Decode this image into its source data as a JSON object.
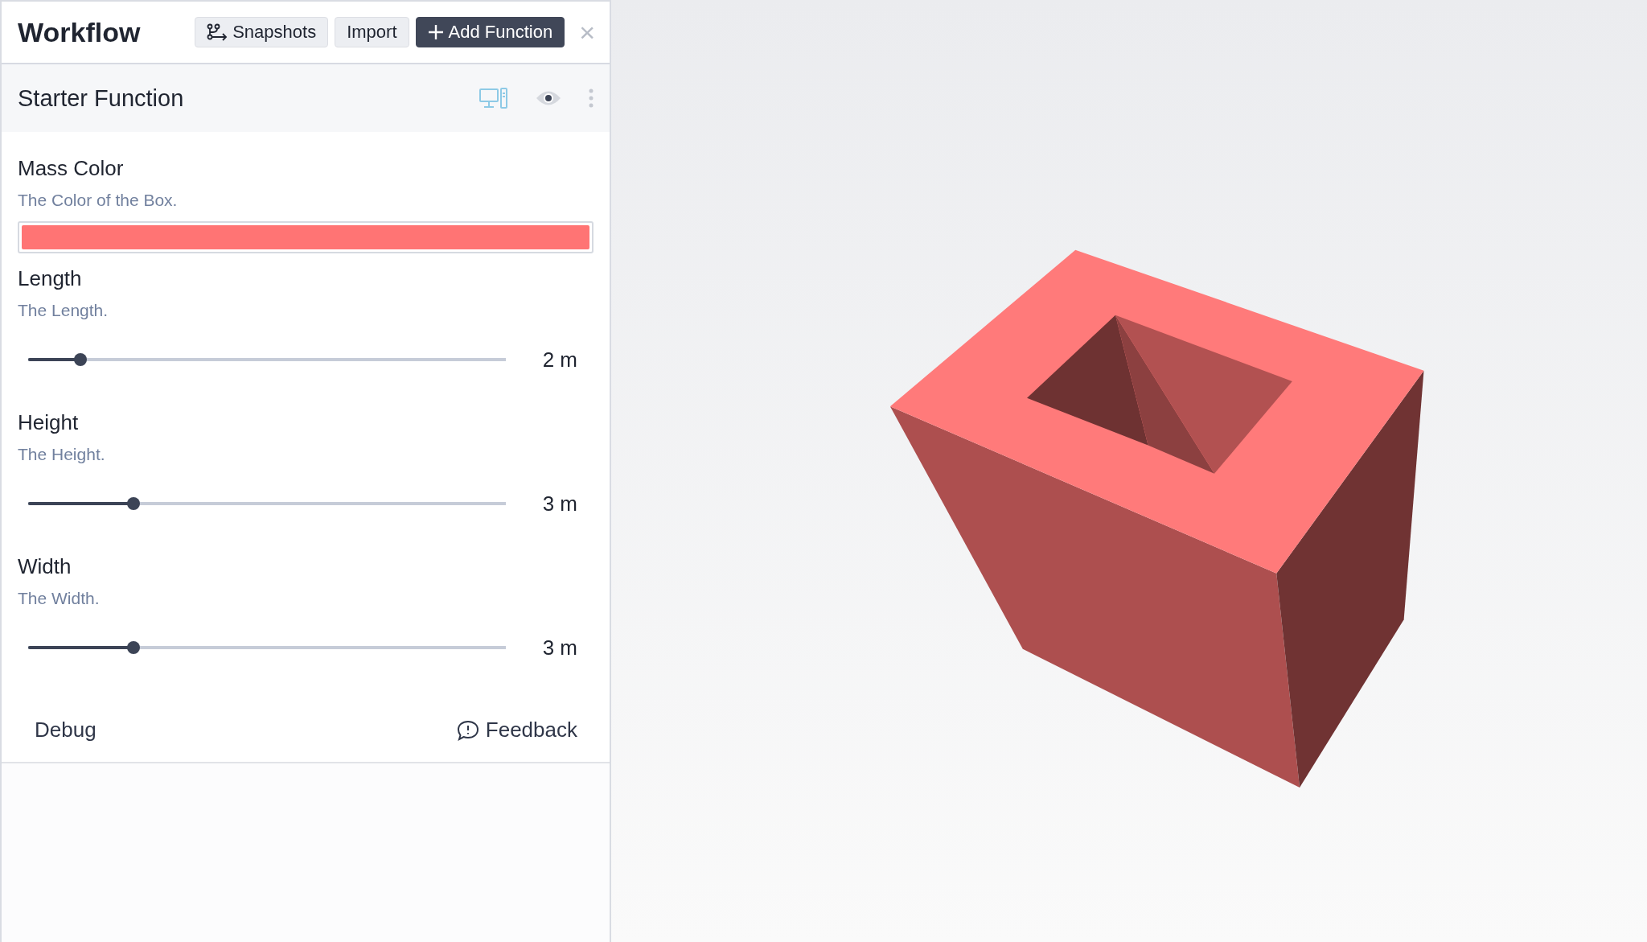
{
  "header": {
    "title": "Workflow",
    "buttons": [
      {
        "label": "Snapshots",
        "kind": "icon"
      },
      {
        "label": "Import",
        "kind": "plain"
      },
      {
        "label": "Add Function",
        "kind": "primary"
      }
    ],
    "close": "×"
  },
  "function": {
    "title": "Starter Function",
    "params": [
      {
        "kind": "color",
        "label": "Mass Color",
        "description": "The Color of the Box.",
        "color": "#ff7474"
      },
      {
        "kind": "slider",
        "label": "Length",
        "description": "The Length.",
        "level": 0.11,
        "reading": "2 m"
      },
      {
        "kind": "slider",
        "label": "Height",
        "description": "The Height.",
        "level": 0.22,
        "reading": "3 m"
      },
      {
        "kind": "slider",
        "label": "Width",
        "description": "The Width.",
        "level": 0.22,
        "reading": "3 m"
      }
    ],
    "footer": {
      "debug": "Debug",
      "feedback": "Feedback"
    }
  }
}
